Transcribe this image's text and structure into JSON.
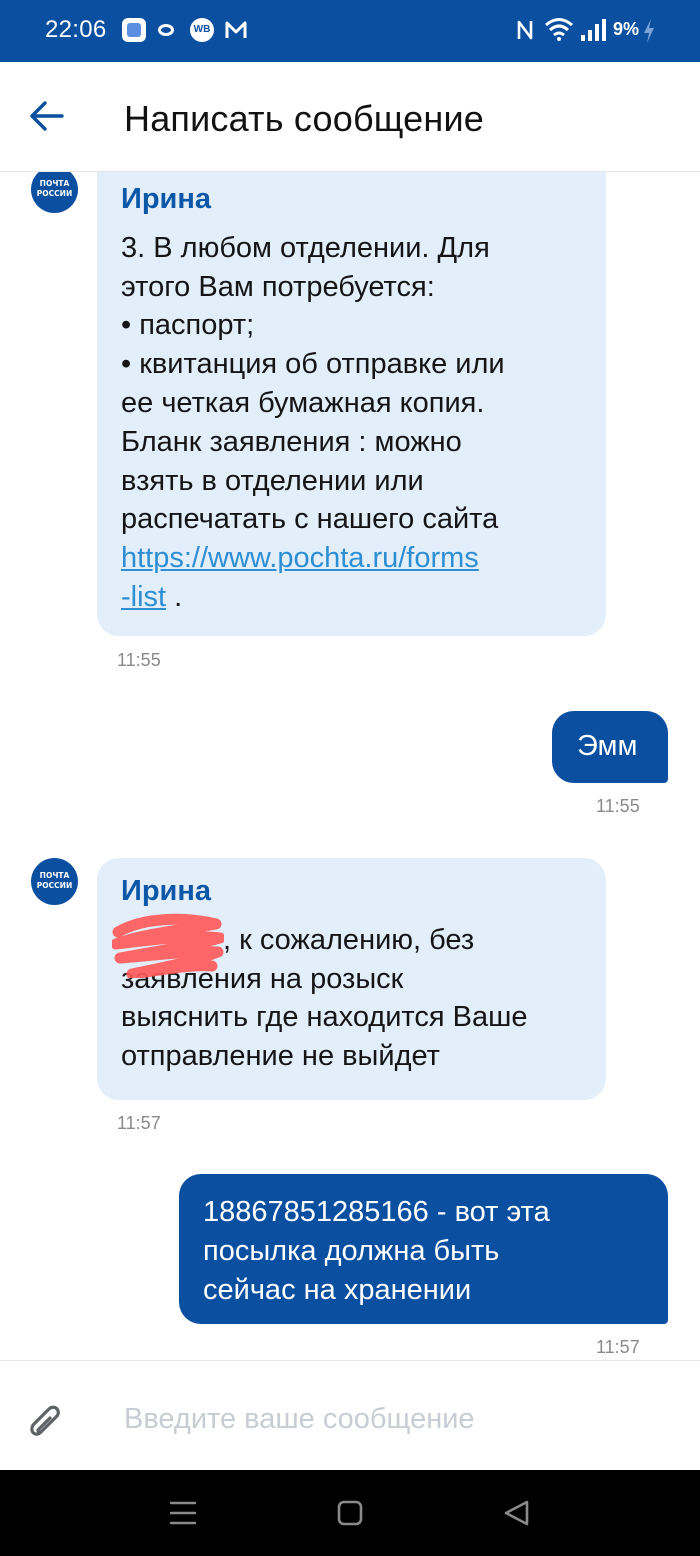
{
  "status_bar": {
    "time": "22:06",
    "app_icons": [
      "app-icon",
      "ring-icon",
      "wb-icon",
      "m-icon"
    ],
    "wb_label": "WB",
    "battery": "9%",
    "indicators": [
      "nfc-icon",
      "wifi-icon",
      "signal-icon",
      "charging-icon"
    ]
  },
  "header": {
    "back_icon": "arrow-left-icon",
    "title": "Написать сообщение"
  },
  "avatar": {
    "line1": "ПОЧТА",
    "line2": "РОССИИ"
  },
  "messages": [
    {
      "direction": "incoming",
      "sender": "Ирина",
      "lines": [
        "3. В любом отделении. Для",
        "этого Вам потребуется:",
        "• паспорт;",
        "• квитанция об отправке или",
        "ее четкая бумажная копия.",
        "Бланк заявления : можно",
        "взять в отделении или",
        "распечатать с нашего сайта"
      ],
      "link_line1": "https://www.pochta.ru/forms",
      "link_line2": "-list",
      "after_link": " .",
      "time": "11:55"
    },
    {
      "direction": "outgoing",
      "text": "Эмм",
      "time": "11:55"
    },
    {
      "direction": "incoming",
      "sender": "Ирина",
      "first_line": ", к сожалению, без",
      "lines": [
        "заявления на розыск",
        "выяснить где находится Ваше",
        "отправление не выйдет"
      ],
      "time": "11:57"
    },
    {
      "direction": "outgoing",
      "lines": [
        "18867851285166 - вот эта",
        "посылка должна быть",
        "сейчас на хранении"
      ],
      "time": "11:57"
    }
  ],
  "input": {
    "attach_icon": "paperclip-icon",
    "placeholder": "Введите ваше сообщение",
    "value": ""
  },
  "nav_bar": {
    "buttons": [
      "menu-icon",
      "home-icon",
      "back-icon"
    ]
  },
  "colors": {
    "brand_blue": "#0a4fa0",
    "incoming_bubble": "#e2eefa",
    "sender_name": "#0d57a8",
    "link": "#2d8ed4",
    "timestamp": "#8a8a8a"
  }
}
